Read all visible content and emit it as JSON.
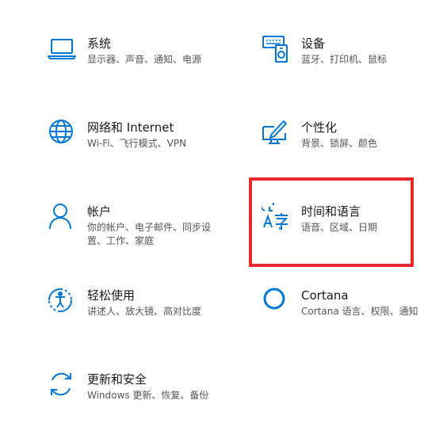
{
  "accent_color": "#0078d7",
  "highlight_color": "#e8282b",
  "tiles": [
    {
      "title": "系统",
      "desc": "显示器、声音、通知、电源",
      "icon": "laptop-icon"
    },
    {
      "title": "设备",
      "desc": "蓝牙、打印机、鼠标",
      "icon": "devices-icon"
    },
    {
      "title": "网络和 Internet",
      "desc": "Wi-Fi、飞行模式、VPN",
      "icon": "globe-icon"
    },
    {
      "title": "个性化",
      "desc": "背景、锁屏、颜色",
      "icon": "personalization-icon"
    },
    {
      "title": "帐户",
      "desc": "你的帐户、电子邮件、同步设置、工作、家庭",
      "icon": "person-icon"
    },
    {
      "title": "时间和语言",
      "desc": "语音、区域、日期",
      "icon": "time-language-icon"
    },
    {
      "title": "轻松使用",
      "desc": "讲述人、放大镜、高对比度",
      "icon": "ease-of-access-icon"
    },
    {
      "title": "Cortana",
      "desc": "Cortana 语言、权限、通知",
      "icon": "cortana-icon"
    },
    {
      "title": "更新和安全",
      "desc": "Windows 更新、恢复、备份",
      "icon": "update-icon"
    }
  ]
}
